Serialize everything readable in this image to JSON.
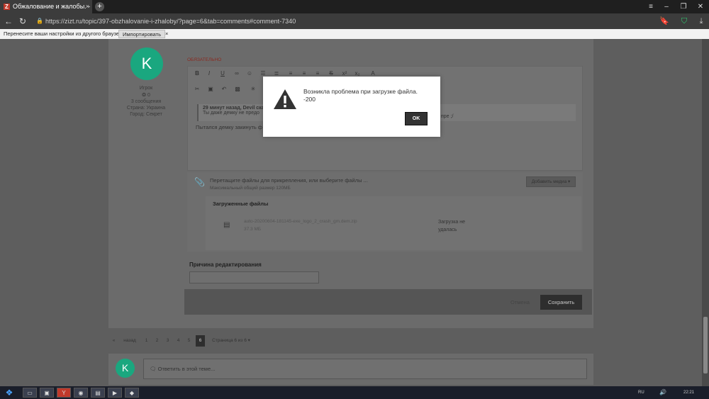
{
  "browser": {
    "tab_title": "Обжалование и жалобы. - Ц",
    "tab_close": "×",
    "new_tab": "+",
    "url": "https://zizt.ru/topic/397-obzhalovanie-i-zhaloby/?page=6&tab=comments#comment-7340",
    "infobar_message": "Перенесите ваши настройки из другого браузера.",
    "import_button": "Импортировать",
    "infobar_close": "×"
  },
  "profile": {
    "avatar_letter": "K",
    "role": "Игрок",
    "reputation": "0",
    "messages": "3 сообщения",
    "country": "Страна: Украина",
    "city": "Город: Секрет"
  },
  "editor": {
    "required": "ОБЯЗАТЕЛЬНО",
    "quote_author": "29 минут назад, Devil сказал:",
    "quote_text": "Ты даже демку не предо",
    "quote_tail": "пре ;/",
    "body_text": "Пытался демку закинуть ф"
  },
  "attachments": {
    "drop_text": "Перетащите файлы для прикрепления, или выберите файлы ...",
    "max_size": "Максимальный общий размер 120МБ",
    "insert_media": "Добавить медиа",
    "uploaded_title": "Загруженные файлы",
    "file_name": "auto-20200604-181145-exe_logo_2_crash_gm.dem.zip",
    "file_size": "37.3 МБ",
    "status": "Загрузка не удалась"
  },
  "edit_reason": {
    "label": "Причина редактирования"
  },
  "actions": {
    "cancel": "Отмена",
    "save": "Сохранить"
  },
  "pagination": {
    "prev_arrow": "«",
    "prev_label": "назад",
    "pages": [
      "1",
      "2",
      "3",
      "4",
      "5",
      "6"
    ],
    "current_page": "6",
    "summary": "Страница 6 из 6 ▾"
  },
  "reply": {
    "avatar_letter": "K",
    "placeholder": "Ответить в этой теме..."
  },
  "modal": {
    "line1": "Возникла проблема при загрузке файла.",
    "line2": "-200",
    "ok": "OK"
  },
  "taskbar": {
    "lang": "RU",
    "time": "22:21"
  },
  "colors": {
    "accent_green": "#1aa77f",
    "dim_overlay": "#5e5e5e",
    "modal_bg": "#ffffff"
  }
}
